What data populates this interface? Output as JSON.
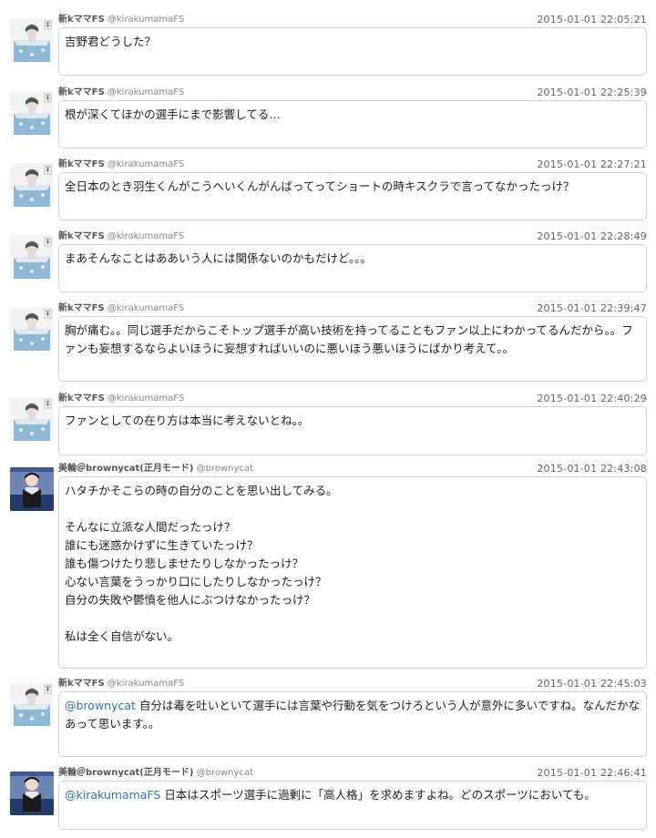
{
  "tweets": [
    {
      "display_name": "新kママFS",
      "screen_name": "@kirakumamaFS",
      "time": "2015-01-01 22:05:21",
      "text": "吉野君どうした？",
      "avatar": "user-a"
    },
    {
      "display_name": "新kママFS",
      "screen_name": "@kirakumamaFS",
      "time": "2015-01-01 22:25:39",
      "text": "根が深くてほかの選手にまで影響してる…",
      "avatar": "user-a"
    },
    {
      "display_name": "新kママFS",
      "screen_name": "@kirakumamaFS",
      "time": "2015-01-01 22:27:21",
      "text": "全日本のとき羽生くんがこうへいくんがんばってってショートの時キスクラで言ってなかったっけ？",
      "avatar": "user-a"
    },
    {
      "display_name": "新kママFS",
      "screen_name": "@kirakumamaFS",
      "time": "2015-01-01 22:28:49",
      "text": "まあそんなことはああいう人には関係ないのかもだけど。。。",
      "avatar": "user-a"
    },
    {
      "display_name": "新kママFS",
      "screen_name": "@kirakumamaFS",
      "time": "2015-01-01 22:39:47",
      "text": "胸が痛む。。同じ選手だからこそトップ選手が高い技術を持ってることもファン以上にわかってるんだから。。ファンも妄想するならよいほうに妄想すればいいのに悪いほう悪いほうにばかり考えて。。",
      "avatar": "user-a"
    },
    {
      "display_name": "新kママFS",
      "screen_name": "@kirakumamaFS",
      "time": "2015-01-01 22:40:29",
      "text": "ファンとしての在り方は本当に考えないとね。。",
      "avatar": "user-a"
    },
    {
      "display_name": "美輪＠brownycat(正月モード)",
      "screen_name": "@brownycat",
      "time": "2015-01-01 22:43:08",
      "text": "ハタチかそこらの時の自分のことを思い出してみる。\n\nそんなに立派な人間だったっけ？\n誰にも迷惑かけずに生きていたっけ？\n誰も傷つけたり悲しませたりしなかったっけ？\n心ない言葉をうっかり口にしたりしなかったっけ？\n自分の失敗や鬱憤を他人にぶつけなかったっけ？\n\n私は全く自信がない。",
      "avatar": "user-b"
    },
    {
      "display_name": "新kママFS",
      "screen_name": "@kirakumamaFS",
      "time": "2015-01-01 22:45:03",
      "mention": "@brownycat",
      "text": " 自分は毒を吐いといて選手には言葉や行動を気をつけろという人が意外に多いですね。なんだかなあって思います。。",
      "avatar": "user-a"
    },
    {
      "display_name": "美輪＠brownycat(正月モード)",
      "screen_name": "@brownycat",
      "time": "2015-01-01 22:46:41",
      "mention": "@kirakumamaFS",
      "text": " 日本はスポーツ選手に過剰に「高人格」を求めますよね。どのスポーツにおいても。",
      "avatar": "user-b"
    }
  ]
}
